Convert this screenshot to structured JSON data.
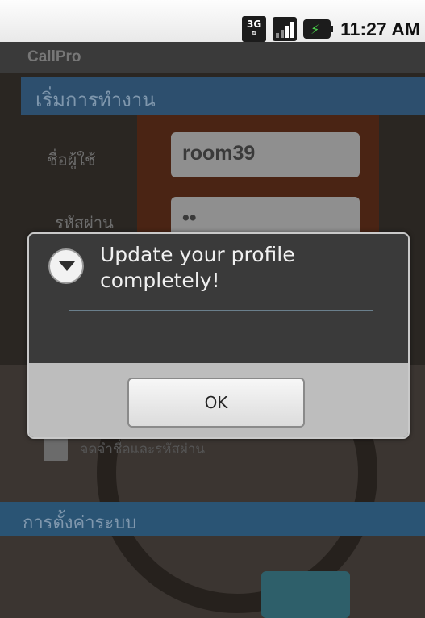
{
  "status_bar": {
    "network": "3G",
    "time": "11:27 AM",
    "icons": [
      "3g-icon",
      "signal-icon",
      "battery-charging-icon"
    ]
  },
  "app": {
    "title": "CallPro",
    "section_title": "เริ่มการทำงาน",
    "username_label": "ชื่อผู้ใช้",
    "username_value": "room39",
    "password_label": "รหัสผ่าน",
    "password_value": "••",
    "remember_label": "จดจำชื่อและรหัสผ่าน",
    "section2_title": "การตั้งค่าระบบ"
  },
  "dialog": {
    "message": "Update your profile completely!",
    "ok_label": "OK",
    "icon": "alert-down-arrow-icon"
  },
  "colors": {
    "dialog_bg": "#3e3e3e",
    "dialog_footer": "#bdbdbd",
    "section_bar": "#2d4f6e"
  }
}
